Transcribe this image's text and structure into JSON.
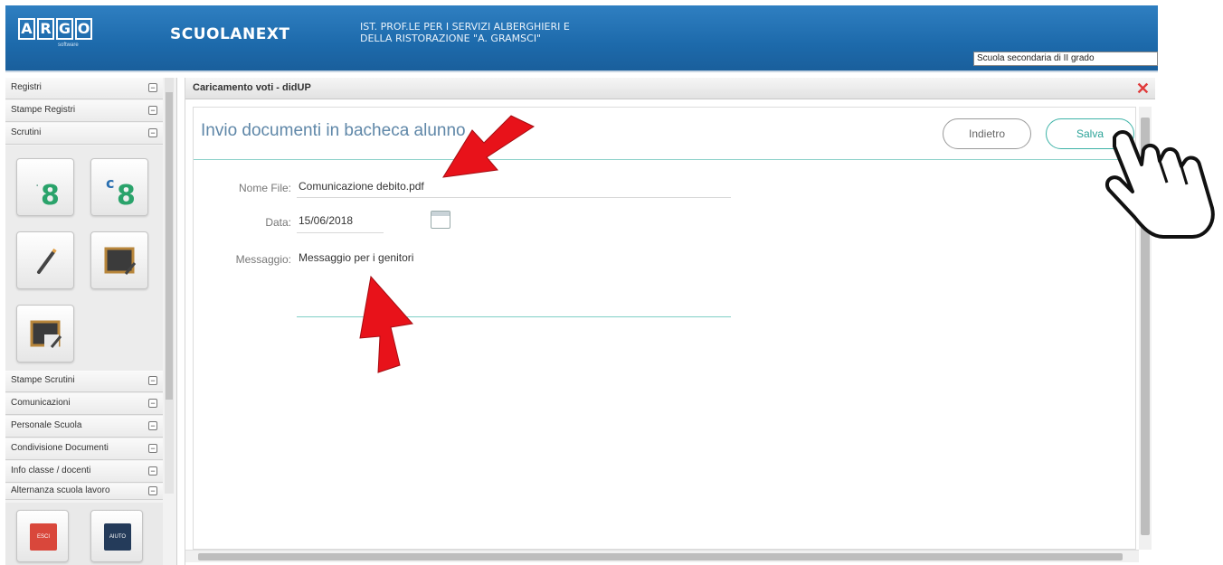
{
  "header": {
    "logo_letters": [
      "A",
      "R",
      "G",
      "O"
    ],
    "logo_sub": "software",
    "app_name": "SCUOLANEXT",
    "school_line1": "IST. PROF.LE PER I SERVIZI ALBERGHIERI E",
    "school_line2": "DELLA RISTORAZIONE \"A. GRAMSCI\"",
    "school_select": "Scuola secondaria di II grado"
  },
  "sidebar": {
    "items_top": [
      {
        "label": "Registri",
        "toggle": "−"
      },
      {
        "label": "Stampe Registri",
        "toggle": "−"
      },
      {
        "label": "Scrutini",
        "toggle": "−"
      }
    ],
    "items_bottom": [
      {
        "label": "Stampe Scrutini",
        "toggle": "−"
      },
      {
        "label": "Comunicazioni",
        "toggle": "−"
      },
      {
        "label": "Personale Scuola",
        "toggle": "−"
      },
      {
        "label": "Condivisione Documenti",
        "toggle": "−"
      },
      {
        "label": "Info classe / docenti",
        "toggle": "−"
      },
      {
        "label": "Alternanza scuola lavoro",
        "toggle": "−"
      }
    ],
    "tile_digits": [
      "8",
      "8"
    ],
    "bottom_icon_labels": [
      "ESCI",
      "AIUTO"
    ]
  },
  "panel": {
    "title": "Caricamento voti - didUP",
    "close": "✕"
  },
  "content": {
    "title": "Invio documenti in bacheca alunno",
    "back_label": "Indietro",
    "save_label": "Salva"
  },
  "form": {
    "filename_label": "Nome File:",
    "filename_value": "Comunicazione debito.pdf",
    "date_label": "Data:",
    "date_value": "15/06/2018",
    "message_label": "Messaggio:",
    "message_value": "Messaggio per i genitori"
  },
  "colors": {
    "header_blue": "#1d6aab",
    "accent_teal": "#3db3a7",
    "annotation_red": "#e8121a"
  },
  "icons": [
    "calendar-icon",
    "close-icon",
    "collapse-icon",
    "pencil-icon",
    "hand-cursor-icon",
    "arrow-annotation"
  ]
}
